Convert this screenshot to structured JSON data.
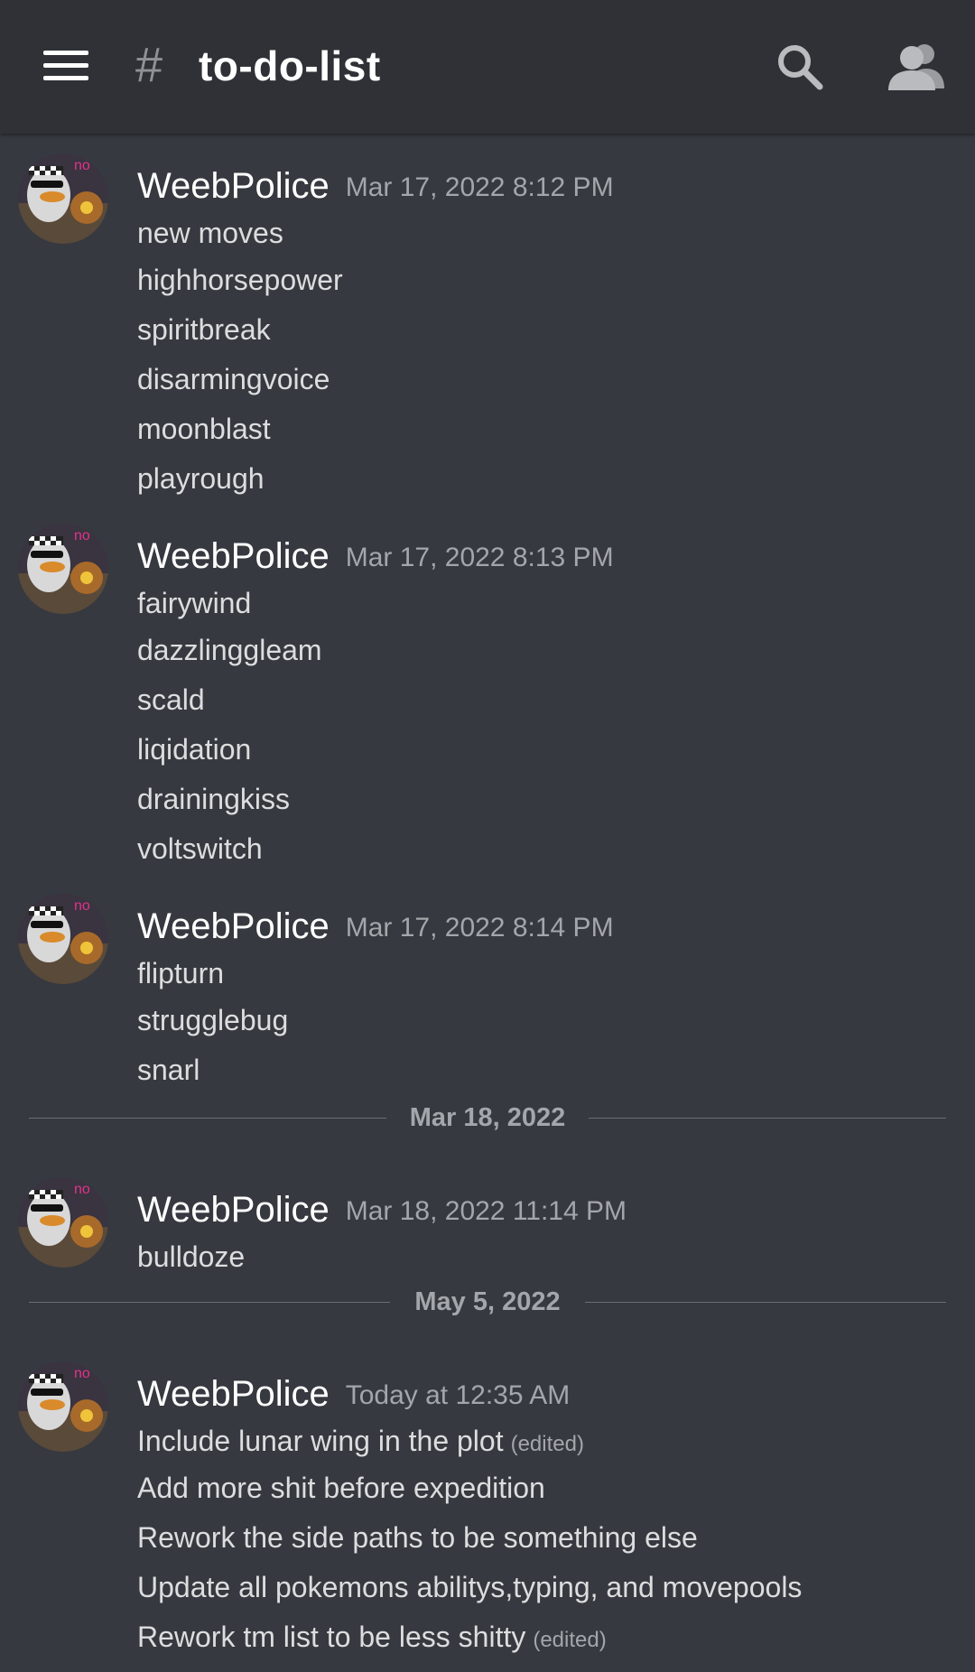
{
  "header": {
    "hash_symbol": "#",
    "channel_name": "to-do-list",
    "search_icon": "search-icon",
    "members_icon": "members-icon",
    "menu_icon": "hamburger-menu-icon"
  },
  "colors": {
    "background": "#36393f",
    "header": "#2f3136",
    "text": "#dcddde",
    "muted": "#a3a6aa",
    "author": "#ffffff"
  },
  "messages": [
    {
      "author": "WeebPolice",
      "timestamp": "Mar 17, 2022 8:12 PM",
      "lines": [
        "new moves",
        "highhorsepower",
        "spiritbreak",
        "disarmingvoice",
        "moonblast",
        "playrough"
      ]
    },
    {
      "author": "WeebPolice",
      "timestamp": "Mar 17, 2022 8:13 PM",
      "lines": [
        "fairywind",
        "dazzlinggleam",
        "scald",
        "liqidation",
        "drainingkiss",
        "voltswitch"
      ]
    },
    {
      "author": "WeebPolice",
      "timestamp": "Mar 17, 2022 8:14 PM",
      "lines": [
        "flipturn",
        "strugglebug",
        "snarl"
      ]
    },
    {
      "author": "WeebPolice",
      "timestamp": "Mar 18, 2022 11:14 PM",
      "lines": [
        "bulldoze"
      ]
    },
    {
      "author": "WeebPolice",
      "timestamp": "Today at 12:35 AM",
      "lines": [
        "Include lunar wing in the plot",
        "Add more shit before expedition",
        "Rework the side paths to be something else",
        "Update all pokemons abilitys,typing, and movepools",
        "Rework tm list to be less shitty"
      ],
      "edited_label": "(edited)"
    }
  ],
  "dividers": [
    "Mar 18, 2022",
    "May 5, 2022"
  ],
  "avatar_badge": "no"
}
